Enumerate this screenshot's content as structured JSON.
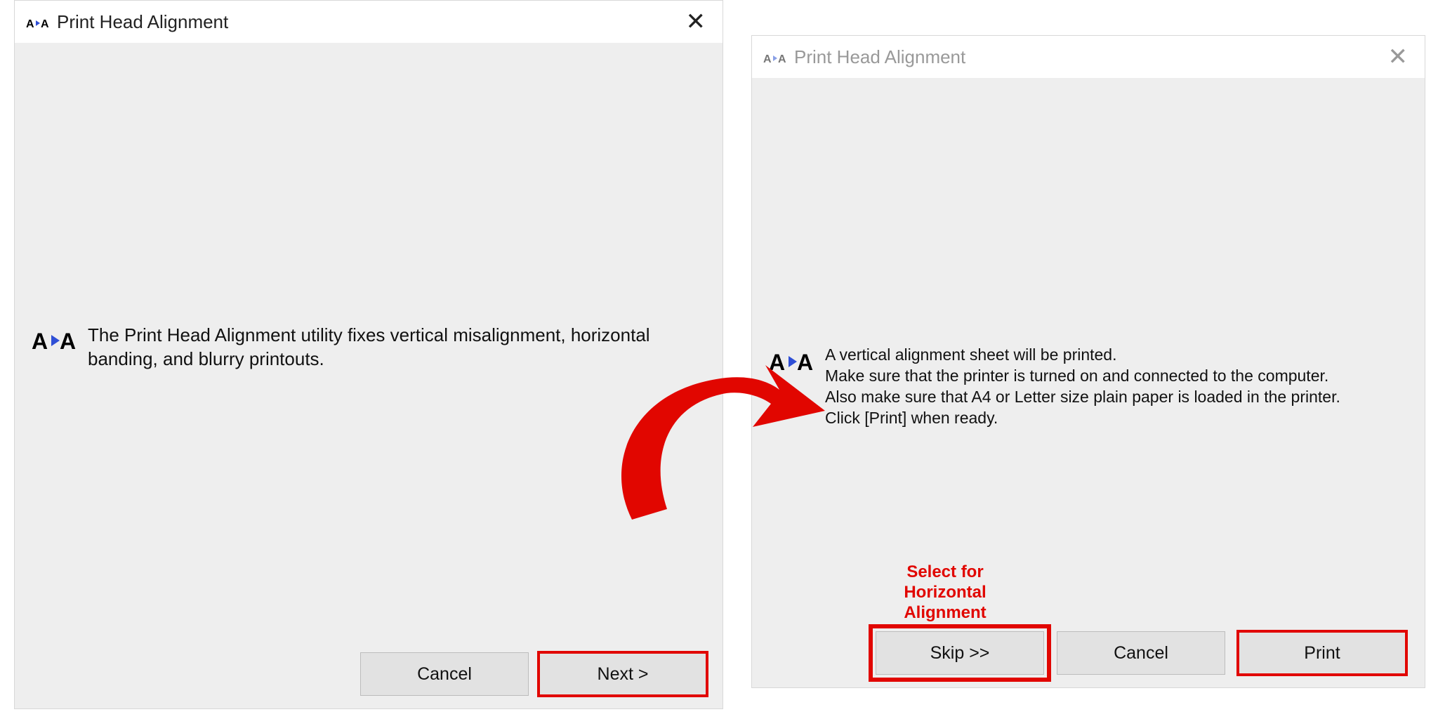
{
  "dialog1": {
    "title": "Print Head Alignment",
    "message": "The Print Head Alignment utility fixes vertical misalignment, horizontal banding, and blurry printouts.",
    "buttons": {
      "cancel": "Cancel",
      "next": "Next >"
    }
  },
  "dialog2": {
    "title": "Print Head Alignment",
    "message": "A vertical alignment sheet will be printed.\nMake sure that the printer is turned on and connected to the computer. Also make sure that A4 or Letter size plain paper is loaded in the printer.\nClick [Print] when ready.",
    "buttons": {
      "skip": "Skip >>",
      "cancel": "Cancel",
      "print": "Print"
    }
  },
  "annotation": {
    "skip_note": "Select for\nHorizontal\nAlignment"
  }
}
